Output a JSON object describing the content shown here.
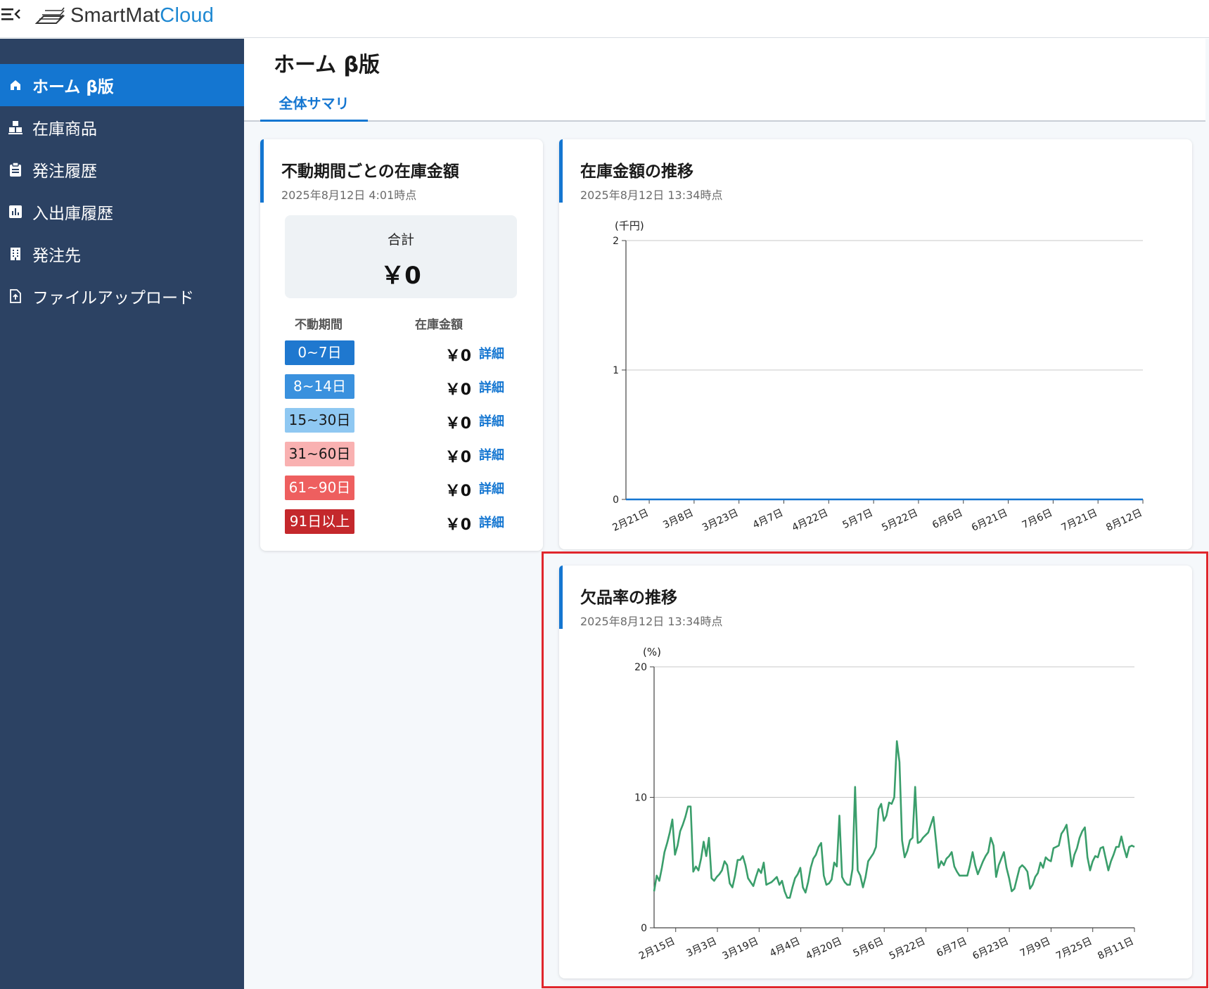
{
  "app": {
    "logo_main": "SmartMat",
    "logo_accent": "Cloud"
  },
  "sidebar": {
    "items": [
      {
        "label": "ホーム β版",
        "icon": "home-icon",
        "active": true
      },
      {
        "label": "在庫商品",
        "icon": "inventory-icon",
        "active": false
      },
      {
        "label": "発注履歴",
        "icon": "clipboard-icon",
        "active": false
      },
      {
        "label": "入出庫履歴",
        "icon": "bar-chart-icon",
        "active": false
      },
      {
        "label": "発注先",
        "icon": "building-icon",
        "active": false
      },
      {
        "label": "ファイルアップロード",
        "icon": "file-upload-icon",
        "active": false
      }
    ]
  },
  "page": {
    "title": "ホーム β版",
    "tabs": [
      {
        "label": "全体サマリ",
        "active": true
      }
    ]
  },
  "aging_card": {
    "title": "不動期間ごとの在庫金額",
    "timestamp": "2025年8月12日 4:01時点",
    "total_label": "合計",
    "total_value": "￥0",
    "col_period": "不動期間",
    "col_amount": "在庫金額",
    "rows": [
      {
        "period": "0~7日",
        "amount": "￥0",
        "link": "詳細",
        "bg": "#1f78cf",
        "fg": "#ffffff"
      },
      {
        "period": "8~14日",
        "amount": "￥0",
        "link": "詳細",
        "bg": "#3a91de",
        "fg": "#ffffff"
      },
      {
        "period": "15~30日",
        "amount": "￥0",
        "link": "詳細",
        "bg": "#8fc8f2",
        "fg": "#1a1a1a"
      },
      {
        "period": "31~60日",
        "amount": "￥0",
        "link": "詳細",
        "bg": "#f9b1b1",
        "fg": "#1a1a1a"
      },
      {
        "period": "61~90日",
        "amount": "￥0",
        "link": "詳細",
        "bg": "#ee5f5f",
        "fg": "#ffffff"
      },
      {
        "period": "91日以上",
        "amount": "￥0",
        "link": "詳細",
        "bg": "#c4282c",
        "fg": "#ffffff"
      }
    ]
  },
  "inventory_card": {
    "title": "在庫金額の推移",
    "timestamp": "2025年8月12日 13:34時点"
  },
  "stockout_card": {
    "title": "欠品率の推移",
    "timestamp": "2025年8月12日 13:34時点"
  },
  "colors": {
    "primary": "#1476d1",
    "sidebar": "#2c4263",
    "line_green": "#3a9e6b",
    "highlight": "#e0262c"
  },
  "chart_data": [
    {
      "type": "line",
      "ylabel": "(千円)",
      "ylim": [
        0,
        2
      ],
      "yticks": [
        0,
        1,
        2
      ],
      "categories": [
        "2月21日",
        "3月8日",
        "3月23日",
        "4月7日",
        "4月22日",
        "5月7日",
        "5月22日",
        "6月6日",
        "6月21日",
        "7月6日",
        "7月21日",
        "8月12日"
      ],
      "series": [
        {
          "values": [
            0,
            0,
            0,
            0,
            0,
            0,
            0,
            0,
            0,
            0,
            0,
            0
          ]
        }
      ],
      "grid": true
    },
    {
      "type": "line",
      "ylabel": "(%)",
      "ylim": [
        0,
        20
      ],
      "yticks": [
        0,
        10,
        20
      ],
      "categories": [
        "2月15日",
        "3月3日",
        "3月19日",
        "4月4日",
        "4月20日",
        "5月6日",
        "5月22日",
        "6月7日",
        "6月23日",
        "7月9日",
        "7月25日",
        "8月11日"
      ],
      "series": [
        {
          "values": [
            2.8,
            4.0,
            3.6,
            4.6,
            5.8,
            6.5,
            7.3,
            8.3,
            5.6,
            6.3,
            7.4,
            7.9,
            8.5,
            9.3,
            9.3,
            4.3,
            4.7,
            4.4,
            5.3,
            6.6,
            5.5,
            6.9,
            3.8,
            3.6,
            3.9,
            4.1,
            4.4,
            5.1,
            4.8,
            3.4,
            3.1,
            4.0,
            5.2,
            5.2,
            5.5,
            4.8,
            3.8,
            3.5,
            3.2,
            3.9,
            4.5,
            4.2,
            5.0,
            3.3,
            3.4,
            3.5,
            3.7,
            3.9,
            3.3,
            3.6,
            2.8,
            2.3,
            2.3,
            3.1,
            3.8,
            4.1,
            4.6,
            3.1,
            2.7,
            3.5,
            4.6,
            5.3,
            5.6,
            6.2,
            6.5,
            4.0,
            3.3,
            3.4,
            3.7,
            5.0,
            4.7,
            8.6,
            3.9,
            3.5,
            3.3,
            3.3,
            4.5,
            10.8,
            4.4,
            4.0,
            3.1,
            3.9,
            5.1,
            5.4,
            5.7,
            6.2,
            9.1,
            9.5,
            8.2,
            8.6,
            9.6,
            9.5,
            10.0,
            14.3,
            12.7,
            6.7,
            5.4,
            5.9,
            6.7,
            6.9,
            10.8,
            6.5,
            6.6,
            6.9,
            7.1,
            7.3,
            7.9,
            8.5,
            6.6,
            4.6,
            5.1,
            4.8,
            5.3,
            5.5,
            5.8,
            4.7,
            4.3,
            4.0,
            4.0,
            4.0,
            4.0,
            4.8,
            5.8,
            4.8,
            4.1,
            4.6,
            5.1,
            5.5,
            5.8,
            6.9,
            6.3,
            3.9,
            4.8,
            5.3,
            5.8,
            4.6,
            3.8,
            2.8,
            3.0,
            3.8,
            4.6,
            4.8,
            4.6,
            4.3,
            3.0,
            3.3,
            3.9,
            4.2,
            5.0,
            4.6,
            5.4,
            5.2,
            5.1,
            6.1,
            6.2,
            6.3,
            7.2,
            7.5,
            7.9,
            6.3,
            4.7,
            5.6,
            6.1,
            6.9,
            7.4,
            7.7,
            5.4,
            4.4,
            5.1,
            5.5,
            5.4,
            6.1,
            6.2,
            5.3,
            4.4,
            5.1,
            5.6,
            6.2,
            6.2,
            7.0,
            6.1,
            5.4,
            6.2,
            6.3,
            6.2
          ]
        }
      ],
      "grid": true
    }
  ]
}
